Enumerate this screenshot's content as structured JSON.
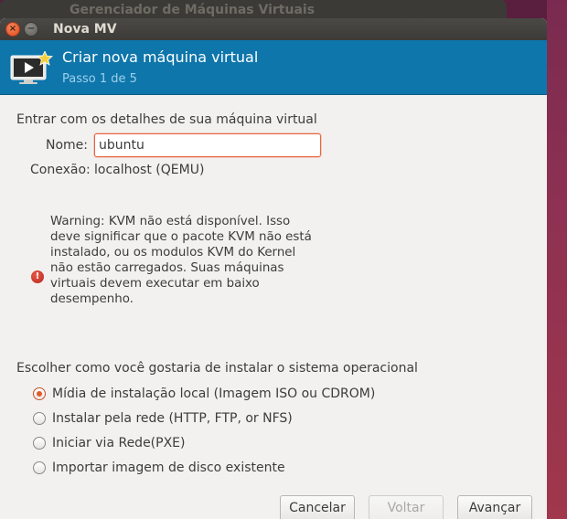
{
  "parent_window": {
    "title": "Gerenciador de Máquinas Virtuais"
  },
  "window": {
    "title": "Nova MV",
    "close_glyph": "×",
    "minimize_glyph": "−"
  },
  "header": {
    "icon": "new-vm-icon",
    "title": "Criar nova máquina virtual",
    "step": "Passo 1 de 5"
  },
  "details": {
    "heading": "Entrar com os detalhes de sua máquina virtual",
    "name_label": "Nome:",
    "name_value": "ubuntu",
    "connection_label": "Conexão:",
    "connection_value": "localhost (QEMU)"
  },
  "warning": {
    "icon": "error-icon",
    "glyph": "!",
    "lines": [
      "Warning: KVM não está disponível. Isso",
      "deve significar que o pacote KVM não está",
      "instalado, ou os modulos KVM do Kernel",
      "não estão carregados. Suas máquinas",
      "virtuais devem executar em baixo",
      "desempenho."
    ]
  },
  "install": {
    "heading": "Escolher como você gostaria de instalar o sistema operacional",
    "options": [
      {
        "label": "Mídia de instalação local (Imagem ISO ou CDROM)",
        "checked": true
      },
      {
        "label": "Instalar pela rede (HTTP, FTP, or NFS)",
        "checked": false
      },
      {
        "label": "Iniciar via Rede(PXE)",
        "checked": false
      },
      {
        "label": "Importar imagem de disco existente",
        "checked": false
      }
    ]
  },
  "buttons": {
    "cancel": "Cancelar",
    "back": "Voltar",
    "forward": "Avançar",
    "back_enabled": false
  },
  "colors": {
    "header_bg": "#0e76ab",
    "accent": "#e05b2d",
    "error": "#c7352a"
  }
}
